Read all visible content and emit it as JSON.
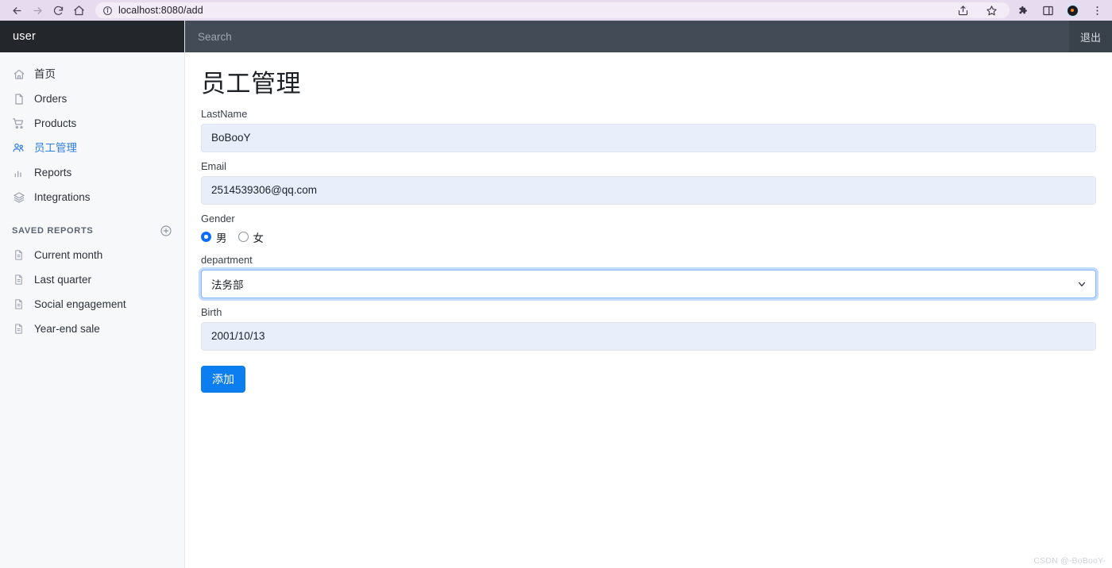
{
  "browser": {
    "back_icon": "back-arrow-icon",
    "forward_icon": "forward-arrow-icon",
    "reload_icon": "reload-icon",
    "home_icon": "home-icon",
    "site_info_icon": "site-info-icon",
    "url": "localhost:8080/add",
    "share_icon": "share-icon",
    "bookmark_icon": "star-icon",
    "extensions_icon": "puzzle-icon",
    "side_panel_icon": "side-panel-icon",
    "profile_icon": "profile-avatar-icon",
    "menu_icon": "three-dot-menu-icon"
  },
  "sidebar": {
    "brand": "user",
    "nav": [
      {
        "label": "首页",
        "icon": "home-icon",
        "active": false
      },
      {
        "label": "Orders",
        "icon": "document-icon",
        "active": false
      },
      {
        "label": "Products",
        "icon": "cart-icon",
        "active": false
      },
      {
        "label": "员工管理",
        "icon": "people-icon",
        "active": true
      },
      {
        "label": "Reports",
        "icon": "bar-chart-icon",
        "active": false
      },
      {
        "label": "Integrations",
        "icon": "layers-icon",
        "active": false
      }
    ],
    "section": {
      "title": "SAVED REPORTS",
      "add_icon": "circle-plus-icon"
    },
    "reports": [
      {
        "label": "Current month",
        "icon": "report-document-icon"
      },
      {
        "label": "Last quarter",
        "icon": "report-document-icon"
      },
      {
        "label": "Social engagement",
        "icon": "report-document-icon"
      },
      {
        "label": "Year-end sale",
        "icon": "report-document-icon"
      }
    ]
  },
  "topbar": {
    "search_placeholder": "Search",
    "search_value": "",
    "logout_label": "退出"
  },
  "page": {
    "title": "员工管理"
  },
  "form": {
    "lastname": {
      "label": "LastName",
      "value": "BoBooY",
      "placeholder": ""
    },
    "email": {
      "label": "Email",
      "value": "2514539306@qq.com",
      "placeholder": ""
    },
    "gender": {
      "label": "Gender",
      "options": [
        {
          "label": "男",
          "checked": true
        },
        {
          "label": "女",
          "checked": false
        }
      ]
    },
    "department": {
      "label": "department",
      "value": "法务部",
      "arrow_icon": "chevron-down-icon"
    },
    "birth": {
      "label": "Birth",
      "value": "2001/10/13",
      "placeholder": ""
    },
    "submit_label": "添加"
  },
  "watermark": "CSDN @-BoBooY-",
  "colors": {
    "accent": "#0d7ef0",
    "active_nav": "#2f7de1",
    "topbar": "#404a54",
    "brand_bar": "#23272b",
    "sidebar_bg": "#f7f8fa",
    "input_bg": "#e9eefb",
    "focus_ring": "#86b7fe"
  }
}
